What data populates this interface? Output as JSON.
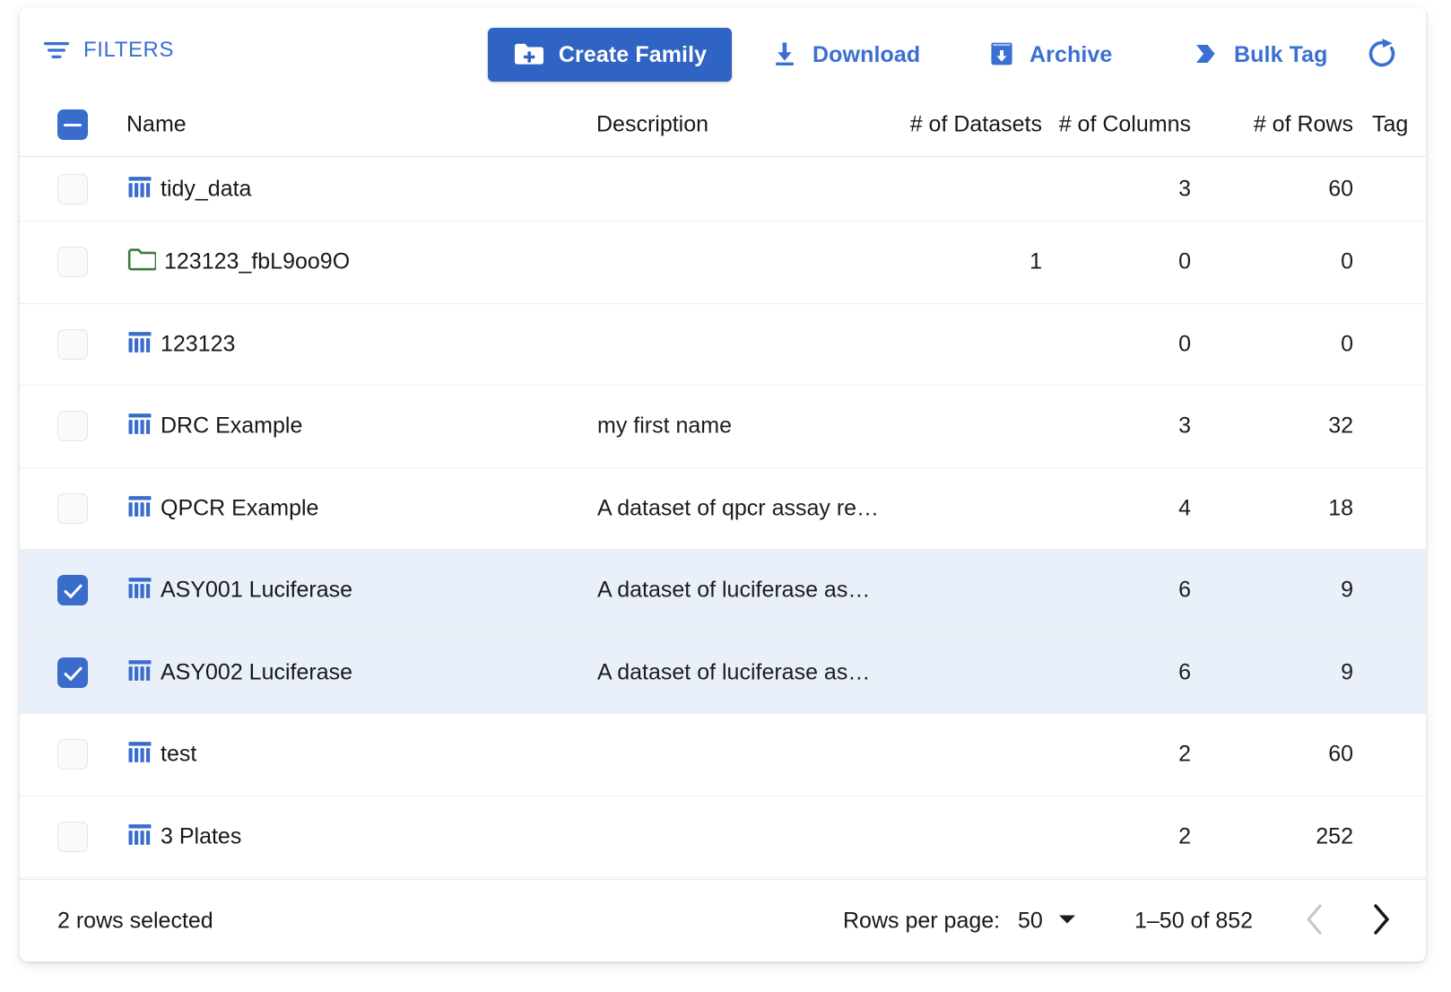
{
  "toolbar": {
    "filters_label": "FILTERS",
    "filters_icon": "filter-list-icon",
    "create_family_label": "Create Family",
    "create_family_icon": "create-new-folder-icon",
    "download_label": "Download",
    "download_icon": "download-icon",
    "archive_label": "Archive",
    "archive_icon": "archive-icon",
    "bulk_tag_label": "Bulk Tag",
    "bulk_tag_icon": "tag-chevron-icon",
    "refresh_icon": "refresh-icon",
    "accent_color": "#3b6fd4",
    "primary_button_color": "#2f63c4"
  },
  "table": {
    "select_all_state": "indeterminate",
    "columns": [
      {
        "key": "name",
        "label": "Name"
      },
      {
        "key": "description",
        "label": "Description"
      },
      {
        "key": "datasets",
        "label": "# of Datasets"
      },
      {
        "key": "columns",
        "label": "# of Columns"
      },
      {
        "key": "rows",
        "label": "# of Rows"
      },
      {
        "key": "tag",
        "label": "Tag"
      }
    ],
    "selected_row_color": "#eaf0fa",
    "rows": [
      {
        "name": "tidy_data",
        "icon": "table-icon",
        "icon_color": "#3a6ccc",
        "description": "",
        "datasets": "",
        "columns": "3",
        "rows": "60",
        "selected": false,
        "clipped": true
      },
      {
        "name": "123123_fbL9oo9O",
        "icon": "folder-icon",
        "icon_color": "#3c7a3c",
        "description": "",
        "datasets": "1",
        "columns": "0",
        "rows": "0",
        "selected": false,
        "clipped": false
      },
      {
        "name": "123123",
        "icon": "table-icon",
        "icon_color": "#3a6ccc",
        "description": "",
        "datasets": "",
        "columns": "0",
        "rows": "0",
        "selected": false,
        "clipped": false
      },
      {
        "name": "DRC Example",
        "icon": "table-icon",
        "icon_color": "#3a6ccc",
        "description": "my first name",
        "datasets": "",
        "columns": "3",
        "rows": "32",
        "selected": false,
        "clipped": false
      },
      {
        "name": "QPCR Example",
        "icon": "table-icon",
        "icon_color": "#3a6ccc",
        "description": "A dataset of qpcr assay re…",
        "datasets": "",
        "columns": "4",
        "rows": "18",
        "selected": false,
        "clipped": false
      },
      {
        "name": "ASY001 Luciferase",
        "icon": "table-icon",
        "icon_color": "#3a6ccc",
        "description": "A dataset of luciferase as…",
        "datasets": "",
        "columns": "6",
        "rows": "9",
        "selected": true,
        "clipped": false
      },
      {
        "name": "ASY002 Luciferase",
        "icon": "table-icon",
        "icon_color": "#3a6ccc",
        "description": "A dataset of luciferase as…",
        "datasets": "",
        "columns": "6",
        "rows": "9",
        "selected": true,
        "clipped": false
      },
      {
        "name": "test",
        "icon": "table-icon",
        "icon_color": "#3a6ccc",
        "description": "",
        "datasets": "",
        "columns": "2",
        "rows": "60",
        "selected": false,
        "clipped": false
      },
      {
        "name": "3 Plates",
        "icon": "table-icon",
        "icon_color": "#3a6ccc",
        "description": "",
        "datasets": "",
        "columns": "2",
        "rows": "252",
        "selected": false,
        "clipped": false
      }
    ]
  },
  "footer": {
    "rows_selected_label": "2 rows selected",
    "rows_per_page_label": "Rows per page:",
    "rows_per_page_value": "50",
    "rows_per_page_caret": "chevron-down-icon",
    "range_label": "1–50 of 852",
    "prev_icon": "chevron-left-icon",
    "next_icon": "chevron-right-icon",
    "prev_enabled": false,
    "next_enabled": true
  }
}
